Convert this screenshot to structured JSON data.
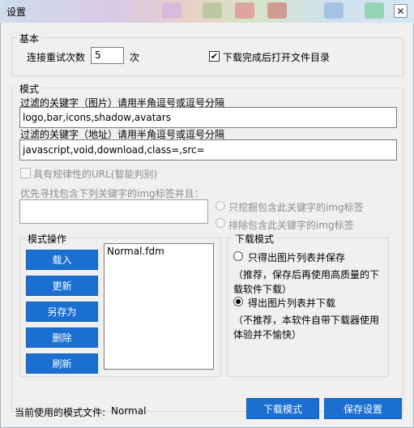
{
  "window": {
    "title": "设置",
    "close_glyph": "✕"
  },
  "basic": {
    "legend": "基本",
    "retry_label": "连接重试次数",
    "retry_value": "5",
    "retry_unit": "次",
    "open_dir_checked": true,
    "open_dir_label": "下载完成后打开文件目录"
  },
  "mode": {
    "legend": "模式",
    "image_filter_label": "过滤的关键字（图片）请用半角逗号或逗号分隔",
    "image_filter_value": "logo,bar,icons,shadow,avatars",
    "url_filter_label": "过滤的关键字（地址）请用半角逗号或逗号分隔",
    "url_filter_value": "javascript,void,download,class=,src=",
    "regular_url_checked": false,
    "regular_url_label": "具有规律性的URL(智能判别)",
    "priority_label": "优先寻找包含下列关键字的img标签并且：",
    "priority_value": "",
    "only_dig_label": "只挖掘包含此关键字的img标签",
    "exclude_label": "排除包含此关键字的img标签"
  },
  "ops": {
    "legend": "模式操作",
    "buttons": [
      "载入",
      "更新",
      "另存为",
      "删除",
      "刷新"
    ],
    "list_items": [
      "Normal.fdm"
    ]
  },
  "download_mode": {
    "legend": "下载模式",
    "option1_label": "只得出图片列表并保存",
    "option1_note": "（推荐，保存后再使用高质量的下载软件下载）",
    "option2_label": "得出图片列表并下载",
    "option2_note": "（不推荐，本软件自带下载器使用体验并不愉快）",
    "selected": 2
  },
  "footer": {
    "current_label": "当前使用的模式文件:",
    "current_value": "Normal",
    "download_mode_button": "下载模式",
    "save_button": "保存设置"
  },
  "colors": {
    "accent": "#1a6fd1",
    "disabled_text": "#8d8d8d"
  }
}
